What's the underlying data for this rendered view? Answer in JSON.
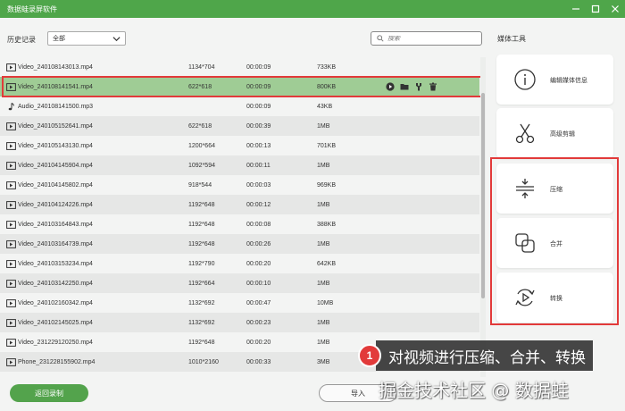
{
  "window": {
    "title": "数据蛙录屏软件"
  },
  "toolbar": {
    "history_label": "历史记录",
    "filter_value": "全部",
    "search_placeholder": "搜索"
  },
  "files": [
    {
      "name": "Video_240108143013.mp4",
      "type": "video",
      "resolution": "1134*704",
      "duration": "00:00:09",
      "size": "733KB"
    },
    {
      "name": "Video_240108141541.mp4",
      "type": "video",
      "resolution": "622*618",
      "duration": "00:00:09",
      "size": "800KB",
      "selected": true
    },
    {
      "name": "Audio_240108141500.mp3",
      "type": "audio",
      "resolution": "",
      "duration": "00:00:09",
      "size": "43KB"
    },
    {
      "name": "Video_240105152641.mp4",
      "type": "video",
      "resolution": "622*618",
      "duration": "00:00:39",
      "size": "1MB"
    },
    {
      "name": "Video_240105143130.mp4",
      "type": "video",
      "resolution": "1200*664",
      "duration": "00:00:13",
      "size": "701KB"
    },
    {
      "name": "Video_240104145904.mp4",
      "type": "video",
      "resolution": "1092*594",
      "duration": "00:00:11",
      "size": "1MB"
    },
    {
      "name": "Video_240104145802.mp4",
      "type": "video",
      "resolution": "918*544",
      "duration": "00:00:03",
      "size": "969KB"
    },
    {
      "name": "Video_240104124226.mp4",
      "type": "video",
      "resolution": "1192*648",
      "duration": "00:00:12",
      "size": "1MB"
    },
    {
      "name": "Video_240103164843.mp4",
      "type": "video",
      "resolution": "1192*648",
      "duration": "00:00:08",
      "size": "388KB"
    },
    {
      "name": "Video_240103164739.mp4",
      "type": "video",
      "resolution": "1192*648",
      "duration": "00:00:26",
      "size": "1MB"
    },
    {
      "name": "Video_240103153234.mp4",
      "type": "video",
      "resolution": "1192*790",
      "duration": "00:00:20",
      "size": "642KB"
    },
    {
      "name": "Video_240103142250.mp4",
      "type": "video",
      "resolution": "1192*664",
      "duration": "00:00:10",
      "size": "1MB"
    },
    {
      "name": "Video_240102160342.mp4",
      "type": "video",
      "resolution": "1132*692",
      "duration": "00:00:47",
      "size": "10MB"
    },
    {
      "name": "Video_240102145025.mp4",
      "type": "video",
      "resolution": "1132*692",
      "duration": "00:00:23",
      "size": "1MB"
    },
    {
      "name": "Video_231229120250.mp4",
      "type": "video",
      "resolution": "1192*648",
      "duration": "00:00:20",
      "size": "1MB"
    },
    {
      "name": "Phone_231228155902.mp4",
      "type": "video",
      "resolution": "1010*2160",
      "duration": "00:00:33",
      "size": "3MB"
    }
  ],
  "row_actions": [
    "play-icon",
    "folder-icon",
    "tools-icon",
    "trash-icon"
  ],
  "side_panel": {
    "title": "媒体工具",
    "tools": [
      {
        "label": "编辑媒体信息",
        "icon": "info-icon"
      },
      {
        "label": "高级剪辑",
        "icon": "scissors-icon"
      },
      {
        "label": "压缩",
        "icon": "compress-icon"
      },
      {
        "label": "合并",
        "icon": "merge-icon"
      },
      {
        "label": "转换",
        "icon": "convert-icon"
      }
    ]
  },
  "bottom": {
    "back_label": "返回录制",
    "import_label": "导入"
  },
  "callout": {
    "number": "1",
    "text": "对视频进行压缩、合并、转换"
  },
  "watermark": "掘金技术社区 @ 数据蛙",
  "colors": {
    "accent": "#4fa64a",
    "selected_row": "#9fcc95",
    "highlight": "#e23a3a"
  }
}
